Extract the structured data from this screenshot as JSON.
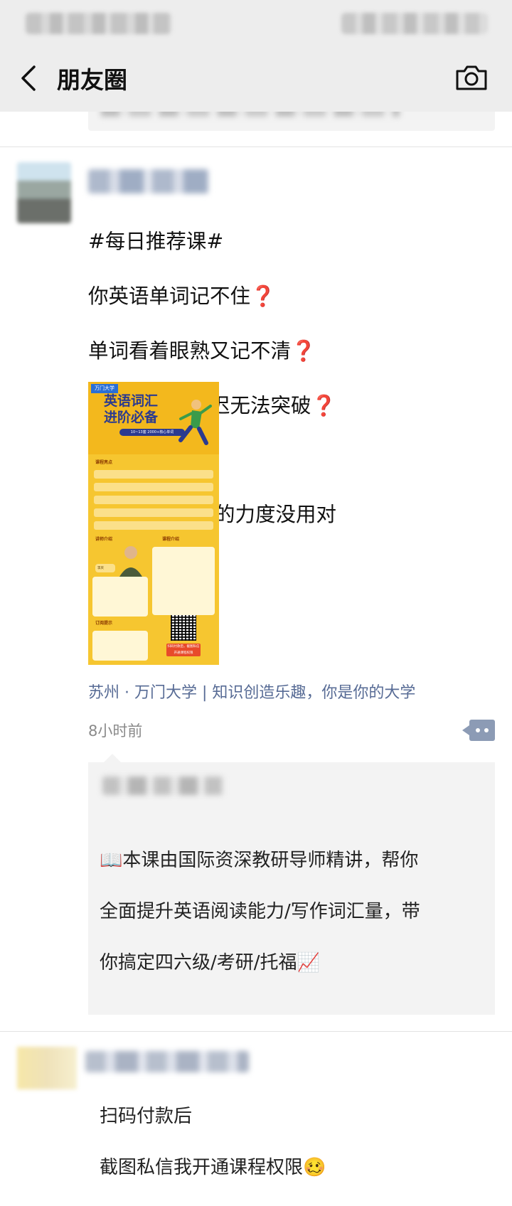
{
  "nav": {
    "title": "朋友圈",
    "back_icon": "chevron-left-icon",
    "camera_icon": "camera-icon"
  },
  "post": {
    "lines": [
      {
        "text": "#每日推荐课#",
        "mark": ""
      },
      {
        "text": "你英语单词记不住",
        "mark": "❓"
      },
      {
        "text": "单词看着眼熟又记不清",
        "mark": "❓"
      },
      {
        "text": "最后词汇量迟迟无法突破",
        "mark": "❓"
      },
      {
        "text": "",
        "mark": ""
      },
      {
        "text": "👉🏼那是因为你的力度没用对",
        "mark": ""
      }
    ],
    "location": "苏州 · 万门大学 | 知识创造乐趣，你是你的大学",
    "time": "8小时前",
    "poster": {
      "logo": "万门大学",
      "title_line1": "英语词汇",
      "title_line2": "进阶必备",
      "subtitle": "10~13套 2000+核心单词",
      "section_features": "课程亮点",
      "section_teacher": "讲师介绍",
      "section_intro": "课程介绍",
      "section_subscribe": "订阅提示",
      "teacher_name": "李庆",
      "qr_note": "扫码付款后，截图私信开通课程权限"
    }
  },
  "comment": {
    "lines": [
      "📖本课由国际资深教研导师精讲，帮你",
      "全面提升英语阅读能力/写作词汇量，带",
      "你搞定四六级/考研/托福📈",
      "",
      "",
      "扫码付款后",
      "截图私信我开通课程权限🥴"
    ]
  },
  "colors": {
    "link": "#576b95",
    "background_bar": "#ededed",
    "comment_bg": "#f3f3f3",
    "question_mark": "#d22b2b",
    "poster_yellow": "#f6c630"
  }
}
